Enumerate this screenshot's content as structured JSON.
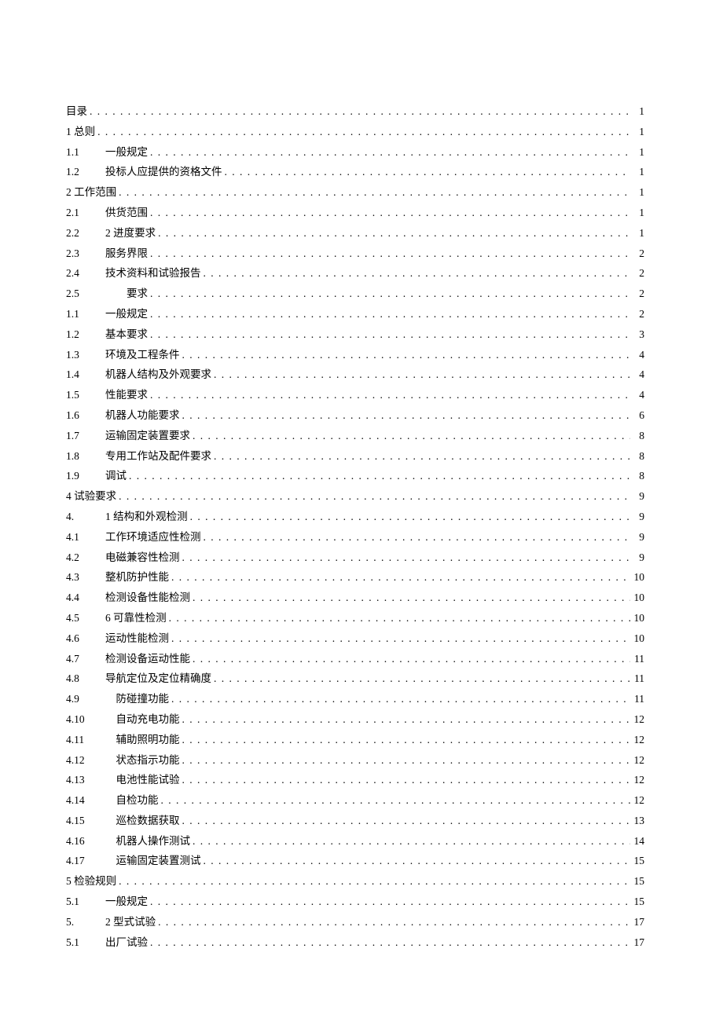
{
  "toc": [
    {
      "num": "",
      "title": "目录",
      "page": "1"
    },
    {
      "num": "",
      "title": "1 总则",
      "page": "1"
    },
    {
      "num": "1.1",
      "title": "一般规定",
      "page": "1"
    },
    {
      "num": "1.2",
      "title": "投标人应提供的资格文件",
      "page": "1"
    },
    {
      "num": "",
      "title": "2 工作范围",
      "page": "1"
    },
    {
      "num": "2.1",
      "title": "供货范围",
      "page": "1"
    },
    {
      "num": "2.2",
      "title": "2 进度要求",
      "page": "1"
    },
    {
      "num": "2.3",
      "title": "服务界限",
      "page": "2"
    },
    {
      "num": "2.4",
      "title": "技术资料和试验报告",
      "page": "2"
    },
    {
      "num": "2.5",
      "title": "　　要求",
      "page": "2"
    },
    {
      "num": "1.1",
      "title": "一般规定",
      "page": "2"
    },
    {
      "num": "1.2",
      "title": "基本要求",
      "page": "3"
    },
    {
      "num": "1.3",
      "title": "环境及工程条件",
      "page": "4"
    },
    {
      "num": "1.4",
      "title": "机器人结构及外观要求",
      "page": "4"
    },
    {
      "num": "1.5",
      "title": "性能要求",
      "page": "4"
    },
    {
      "num": "1.6",
      "title": "机器人功能要求",
      "page": "6"
    },
    {
      "num": "1.7",
      "title": "运输固定装置要求",
      "page": "8"
    },
    {
      "num": "1.8",
      "title": "专用工作站及配件要求",
      "page": "8"
    },
    {
      "num": "1.9",
      "title": "调试",
      "page": "8"
    },
    {
      "num": "",
      "title": "4 试验要求",
      "page": "9"
    },
    {
      "num": "4.",
      "title": "1 结构和外观检测",
      "page": "9"
    },
    {
      "num": "4.1",
      "title": "工作环境适应性检测",
      "page": "9"
    },
    {
      "num": "4.2",
      "title": "电磁兼容性检测",
      "page": "9"
    },
    {
      "num": "4.3",
      "title": "整机防护性能",
      "page": "10"
    },
    {
      "num": "4.4",
      "title": "检测设备性能检测",
      "page": "10"
    },
    {
      "num": "4.5",
      "title": "6 可靠性检测",
      "page": "10"
    },
    {
      "num": "4.6",
      "title": "运动性能检测",
      "page": "10"
    },
    {
      "num": "4.7",
      "title": "检测设备运动性能",
      "page": "11"
    },
    {
      "num": "4.8",
      "title": "导航定位及定位精确度",
      "page": "11"
    },
    {
      "num": "4.9",
      "title": "　防碰撞功能",
      "page": "11"
    },
    {
      "num": "4.10",
      "title": "　自动充电功能",
      "page": "12"
    },
    {
      "num": "4.11",
      "title": "　辅助照明功能",
      "page": "12"
    },
    {
      "num": "4.12",
      "title": "　状态指示功能",
      "page": "12"
    },
    {
      "num": "4.13",
      "title": "　电池性能试验",
      "page": "12"
    },
    {
      "num": "4.14",
      "title": "　自检功能",
      "page": "12"
    },
    {
      "num": "4.15",
      "title": "　巡检数据获取",
      "page": "13"
    },
    {
      "num": "4.16",
      "title": "　机器人操作测试",
      "page": "14"
    },
    {
      "num": "4.17",
      "title": "　运输固定装置测试",
      "page": "15"
    },
    {
      "num": "",
      "title": "5 检验规则",
      "page": "15"
    },
    {
      "num": "5.1",
      "title": "一般规定",
      "page": "15"
    },
    {
      "num": "5.",
      "title": "2 型式试验",
      "page": "17"
    },
    {
      "num": "5.1",
      "title": "出厂试验",
      "page": "17"
    }
  ]
}
